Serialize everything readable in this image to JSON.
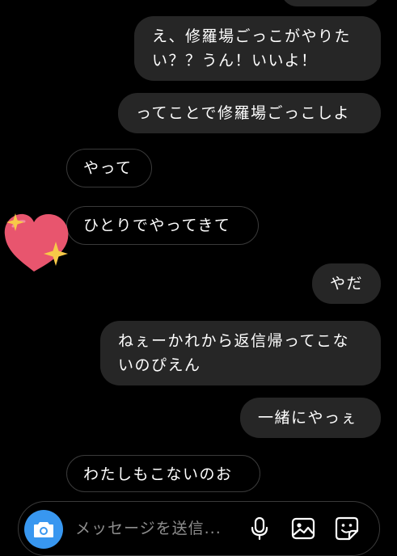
{
  "messages": [
    {
      "side": "sent",
      "lines": [
        "え、修羅場ごっこがやりた",
        "い？？うん！いいよ！"
      ]
    },
    {
      "side": "sent",
      "lines": [
        "ってことで修羅場ごっこしよ"
      ]
    },
    {
      "side": "received",
      "lines": [
        "やって"
      ]
    },
    {
      "side": "received",
      "lines": [
        "ひとりでやってきて"
      ],
      "reaction": "sparkling-heart"
    },
    {
      "side": "sent",
      "lines": [
        "やだ"
      ]
    },
    {
      "side": "sent",
      "lines": [
        "ねぇーかれから返信帰ってこな",
        "いのぴえん"
      ]
    },
    {
      "side": "sent",
      "lines": [
        "一緒にやっぇ"
      ]
    },
    {
      "side": "received",
      "lines": [
        "わたしもこないのお"
      ]
    }
  ],
  "composer": {
    "placeholder": "メッセージを送信...",
    "icons": [
      "camera-icon",
      "microphone-icon",
      "image-icon",
      "sticker-icon"
    ]
  },
  "colors": {
    "background": "#000000",
    "sent_bubble": "#262626",
    "received_border": "#3a3a3a",
    "camera_button": "#3897f0",
    "heart": "#e8556e",
    "sparkle": "#f7c948",
    "placeholder": "#8e8e8e"
  }
}
